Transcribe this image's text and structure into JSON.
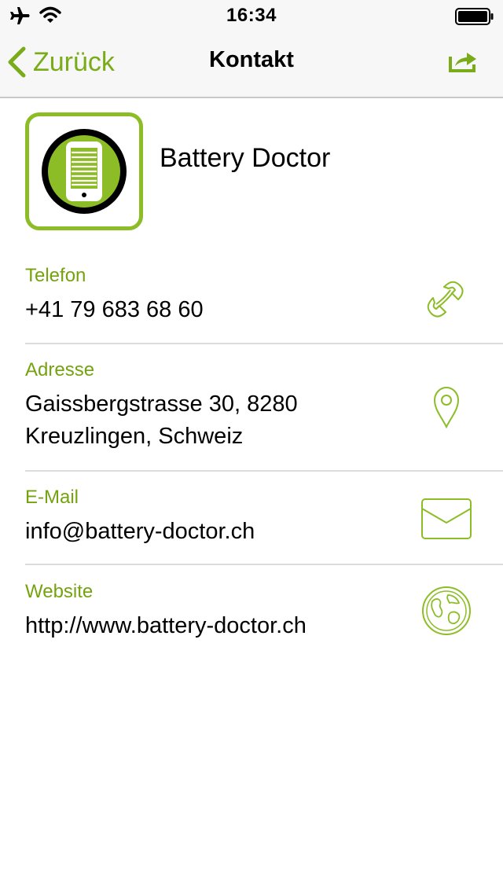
{
  "status_bar": {
    "time": "16:34"
  },
  "nav": {
    "back_label": "Zurück",
    "title": "Kontakt"
  },
  "header": {
    "company_name": "Battery Doctor"
  },
  "contact": [
    {
      "label": "Telefon",
      "value": "+41 79 683 68 60",
      "icon": "phone-icon"
    },
    {
      "label": "Adresse",
      "value_lines": [
        "Gaissbergstrasse 30, 8280",
        "Kreuzlingen, Schweiz"
      ],
      "icon": "map-pin-icon"
    },
    {
      "label": "E-Mail",
      "value": "info@battery-doctor.ch",
      "icon": "mail-icon"
    },
    {
      "label": "Website",
      "value": "http://www.battery-doctor.ch",
      "icon": "globe-icon"
    }
  ],
  "colors": {
    "accent": "#7aab19",
    "logo_green": "#8dbd26"
  }
}
